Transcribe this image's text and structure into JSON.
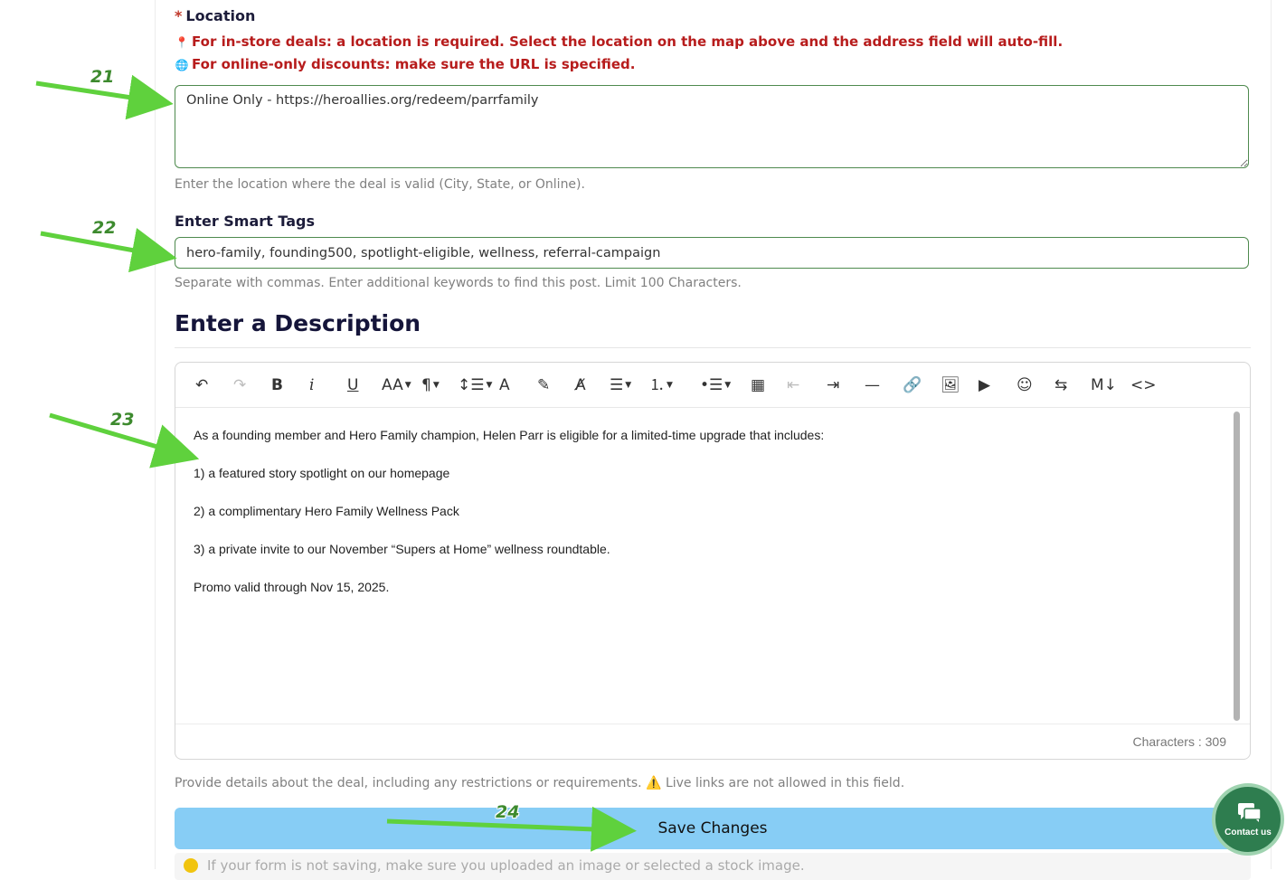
{
  "location": {
    "label": "Location",
    "required_mark": "*",
    "warning_instore": "For in-store deals: a location is required. Select the location on the map above and the address field will auto-fill.",
    "warning_online": "For online-only discounts: make sure the URL is specified.",
    "value": "Online Only - https://heroallies.org/redeem/parrfamily",
    "help": "Enter the location where the deal is valid (City, State, or Online)."
  },
  "tags": {
    "label": "Enter Smart Tags",
    "value": "hero-family, founding500, spotlight-eligible, wellness, referral-campaign",
    "help": "Separate with commas. Enter additional keywords to find this post. Limit 100 Characters."
  },
  "description": {
    "title": "Enter a Description",
    "toolbar": [
      {
        "name": "undo-icon",
        "glyph": "↶"
      },
      {
        "name": "redo-icon",
        "glyph": "↷",
        "disabled": true
      },
      {
        "name": "bold-icon",
        "glyph": "B"
      },
      {
        "name": "italic-icon",
        "glyph": "i"
      },
      {
        "name": "underline-icon",
        "glyph": "U"
      },
      {
        "name": "font-size-icon",
        "glyph": "AA"
      },
      {
        "name": "paragraph-format-icon",
        "glyph": "¶"
      },
      {
        "name": "line-height-icon",
        "glyph": "↕☰"
      },
      {
        "name": "text-color-icon",
        "glyph": "A"
      },
      {
        "name": "highlight-icon",
        "glyph": "✎"
      },
      {
        "name": "clear-format-icon",
        "glyph": "A̸"
      },
      {
        "name": "align-icon",
        "glyph": "☰"
      },
      {
        "name": "ordered-list-icon",
        "glyph": "⒈"
      },
      {
        "name": "unordered-list-icon",
        "glyph": "•☰"
      },
      {
        "name": "table-icon",
        "glyph": "▦"
      },
      {
        "name": "outdent-icon",
        "glyph": "⇤",
        "disabled": true
      },
      {
        "name": "indent-icon",
        "glyph": "⇥"
      },
      {
        "name": "horizontal-line-icon",
        "glyph": "—"
      },
      {
        "name": "link-icon",
        "glyph": "🔗"
      },
      {
        "name": "image-icon",
        "glyph": "🖼"
      },
      {
        "name": "video-icon",
        "glyph": "▶"
      },
      {
        "name": "emoji-icon",
        "glyph": "☺"
      },
      {
        "name": "share-icon",
        "glyph": "⇆"
      },
      {
        "name": "markdown-icon",
        "glyph": "M↓"
      },
      {
        "name": "code-view-icon",
        "glyph": "<>"
      }
    ],
    "paragraphs": [
      "As a founding member and Hero Family champion, Helen Parr is eligible for a limited-time upgrade that includes:",
      "1) a featured story spotlight on our homepage",
      "2) a complimentary Hero Family Wellness Pack",
      " 3) a private invite to our November “Supers at Home” wellness roundtable.",
      "Promo valid through Nov 15, 2025."
    ],
    "char_count": "Characters : 309",
    "help": "Provide details about the deal, including any restrictions or requirements. ⚠️ Live links are not allowed in this field."
  },
  "save_label": "Save Changes",
  "bottom_note": "If your form is not saving, make sure you uploaded an image or selected a stock image.",
  "contact_label": "Contact us",
  "annotations": [
    "21",
    "22",
    "23",
    "24"
  ],
  "colors": {
    "arrow": "#5fd13d",
    "save": "#87cdf5",
    "warning": "#b71c1c",
    "contact": "#2e7d4f"
  }
}
